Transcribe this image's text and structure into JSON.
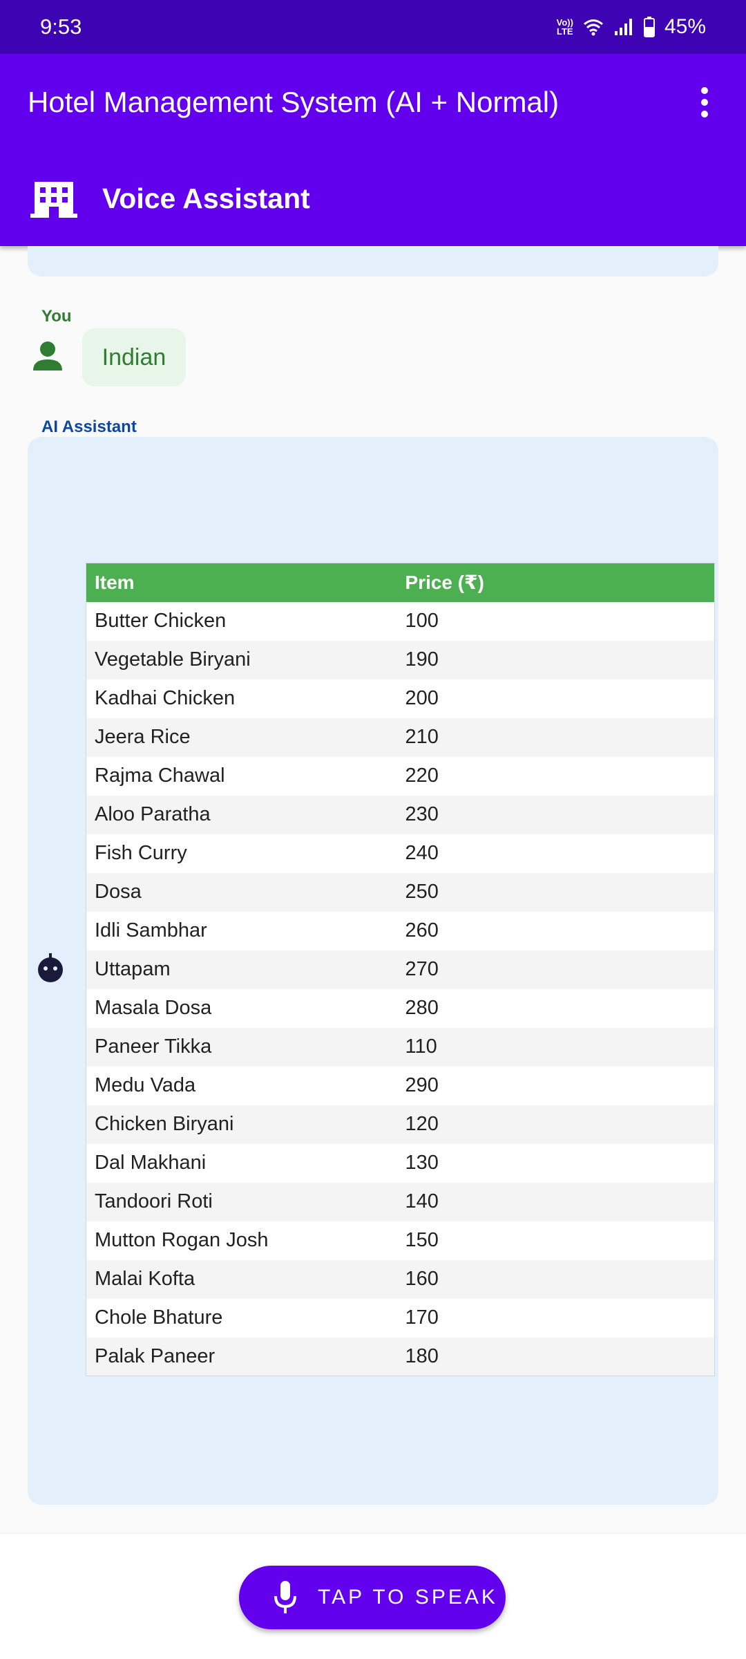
{
  "status_bar": {
    "time": "9:53",
    "volte": "Vo))\nLTE",
    "battery": "45%"
  },
  "app_bar": {
    "title": "Hotel Management System (AI + Normal)",
    "menu_icon": "more-vert-icon"
  },
  "section": {
    "icon": "building-icon",
    "title": "Voice Assistant"
  },
  "chat": {
    "user_label": "You",
    "user_message": "Indian",
    "ai_label": "AI Assistant",
    "table": {
      "headers": [
        "Item",
        "Price (₹)"
      ],
      "rows": [
        [
          "Butter Chicken",
          "100"
        ],
        [
          "Vegetable Biryani",
          "190"
        ],
        [
          "Kadhai Chicken",
          "200"
        ],
        [
          "Jeera Rice",
          "210"
        ],
        [
          "Rajma Chawal",
          "220"
        ],
        [
          "Aloo Paratha",
          "230"
        ],
        [
          "Fish Curry",
          "240"
        ],
        [
          "Dosa",
          "250"
        ],
        [
          "Idli Sambhar",
          "260"
        ],
        [
          "Uttapam",
          "270"
        ],
        [
          "Masala Dosa",
          "280"
        ],
        [
          "Paneer Tikka",
          "110"
        ],
        [
          "Medu Vada",
          "290"
        ],
        [
          "Chicken Biryani",
          "120"
        ],
        [
          "Dal Makhani",
          "130"
        ],
        [
          "Tandoori Roti",
          "140"
        ],
        [
          "Mutton Rogan Josh",
          "150"
        ],
        [
          "Malai Kofta",
          "160"
        ],
        [
          "Chole Bhature",
          "170"
        ],
        [
          "Palak Paneer",
          "180"
        ]
      ]
    }
  },
  "speak_button": {
    "icon": "mic-icon",
    "label": "TAP TO SPEAK"
  },
  "colors": {
    "status_bar": "#3e04b4",
    "primary": "#6200ee",
    "user_text": "#2e7d32",
    "ai_label": "#0d47a1",
    "ai_bubble": "#e3f0fb",
    "table_header": "#4caf50"
  }
}
